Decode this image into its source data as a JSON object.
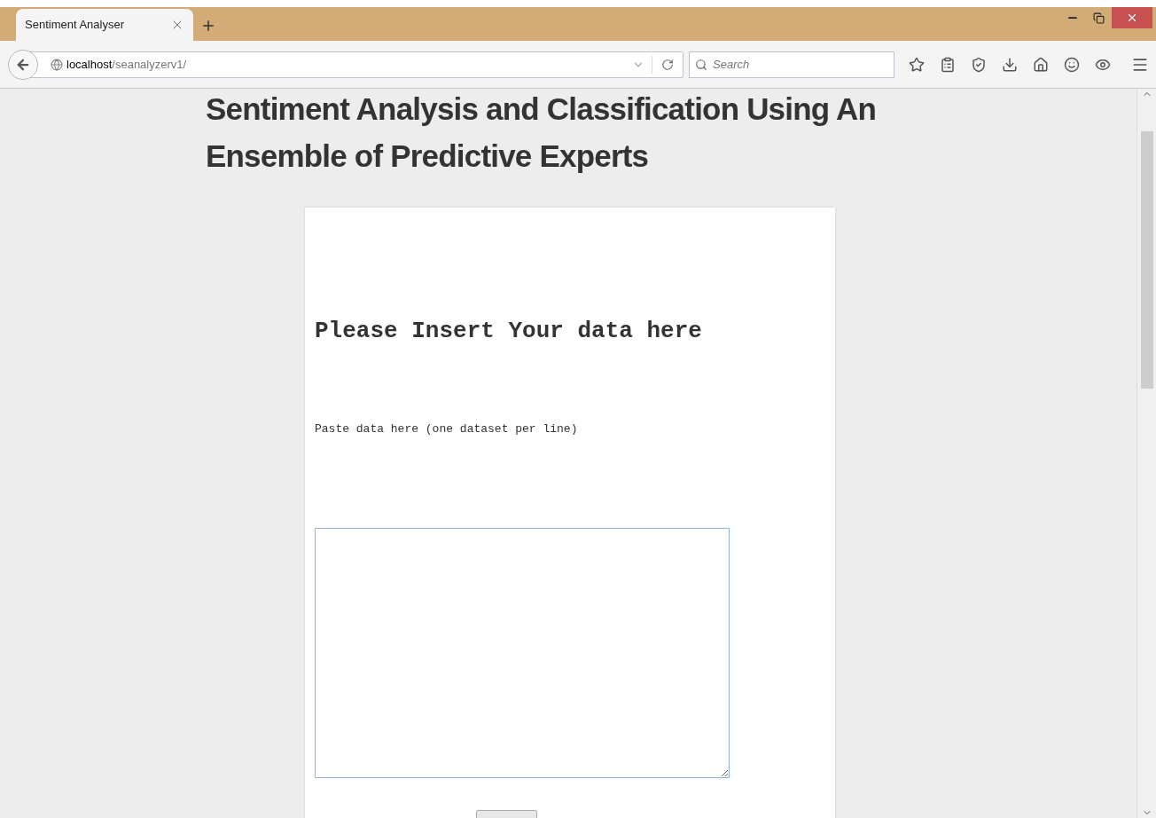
{
  "tabs": [
    {
      "title": "Sentiment Analyser",
      "selected": true
    }
  ],
  "address_bar": {
    "host": "localhost",
    "path": "/seanalyzerv1/"
  },
  "search": {
    "placeholder": "Search"
  },
  "page": {
    "title": "Sentiment Analysis and Classification Using An Ensemble of Predictive Experts",
    "form_heading": "Please Insert Your data here",
    "field_label": "Paste data here (one dataset per line)"
  }
}
